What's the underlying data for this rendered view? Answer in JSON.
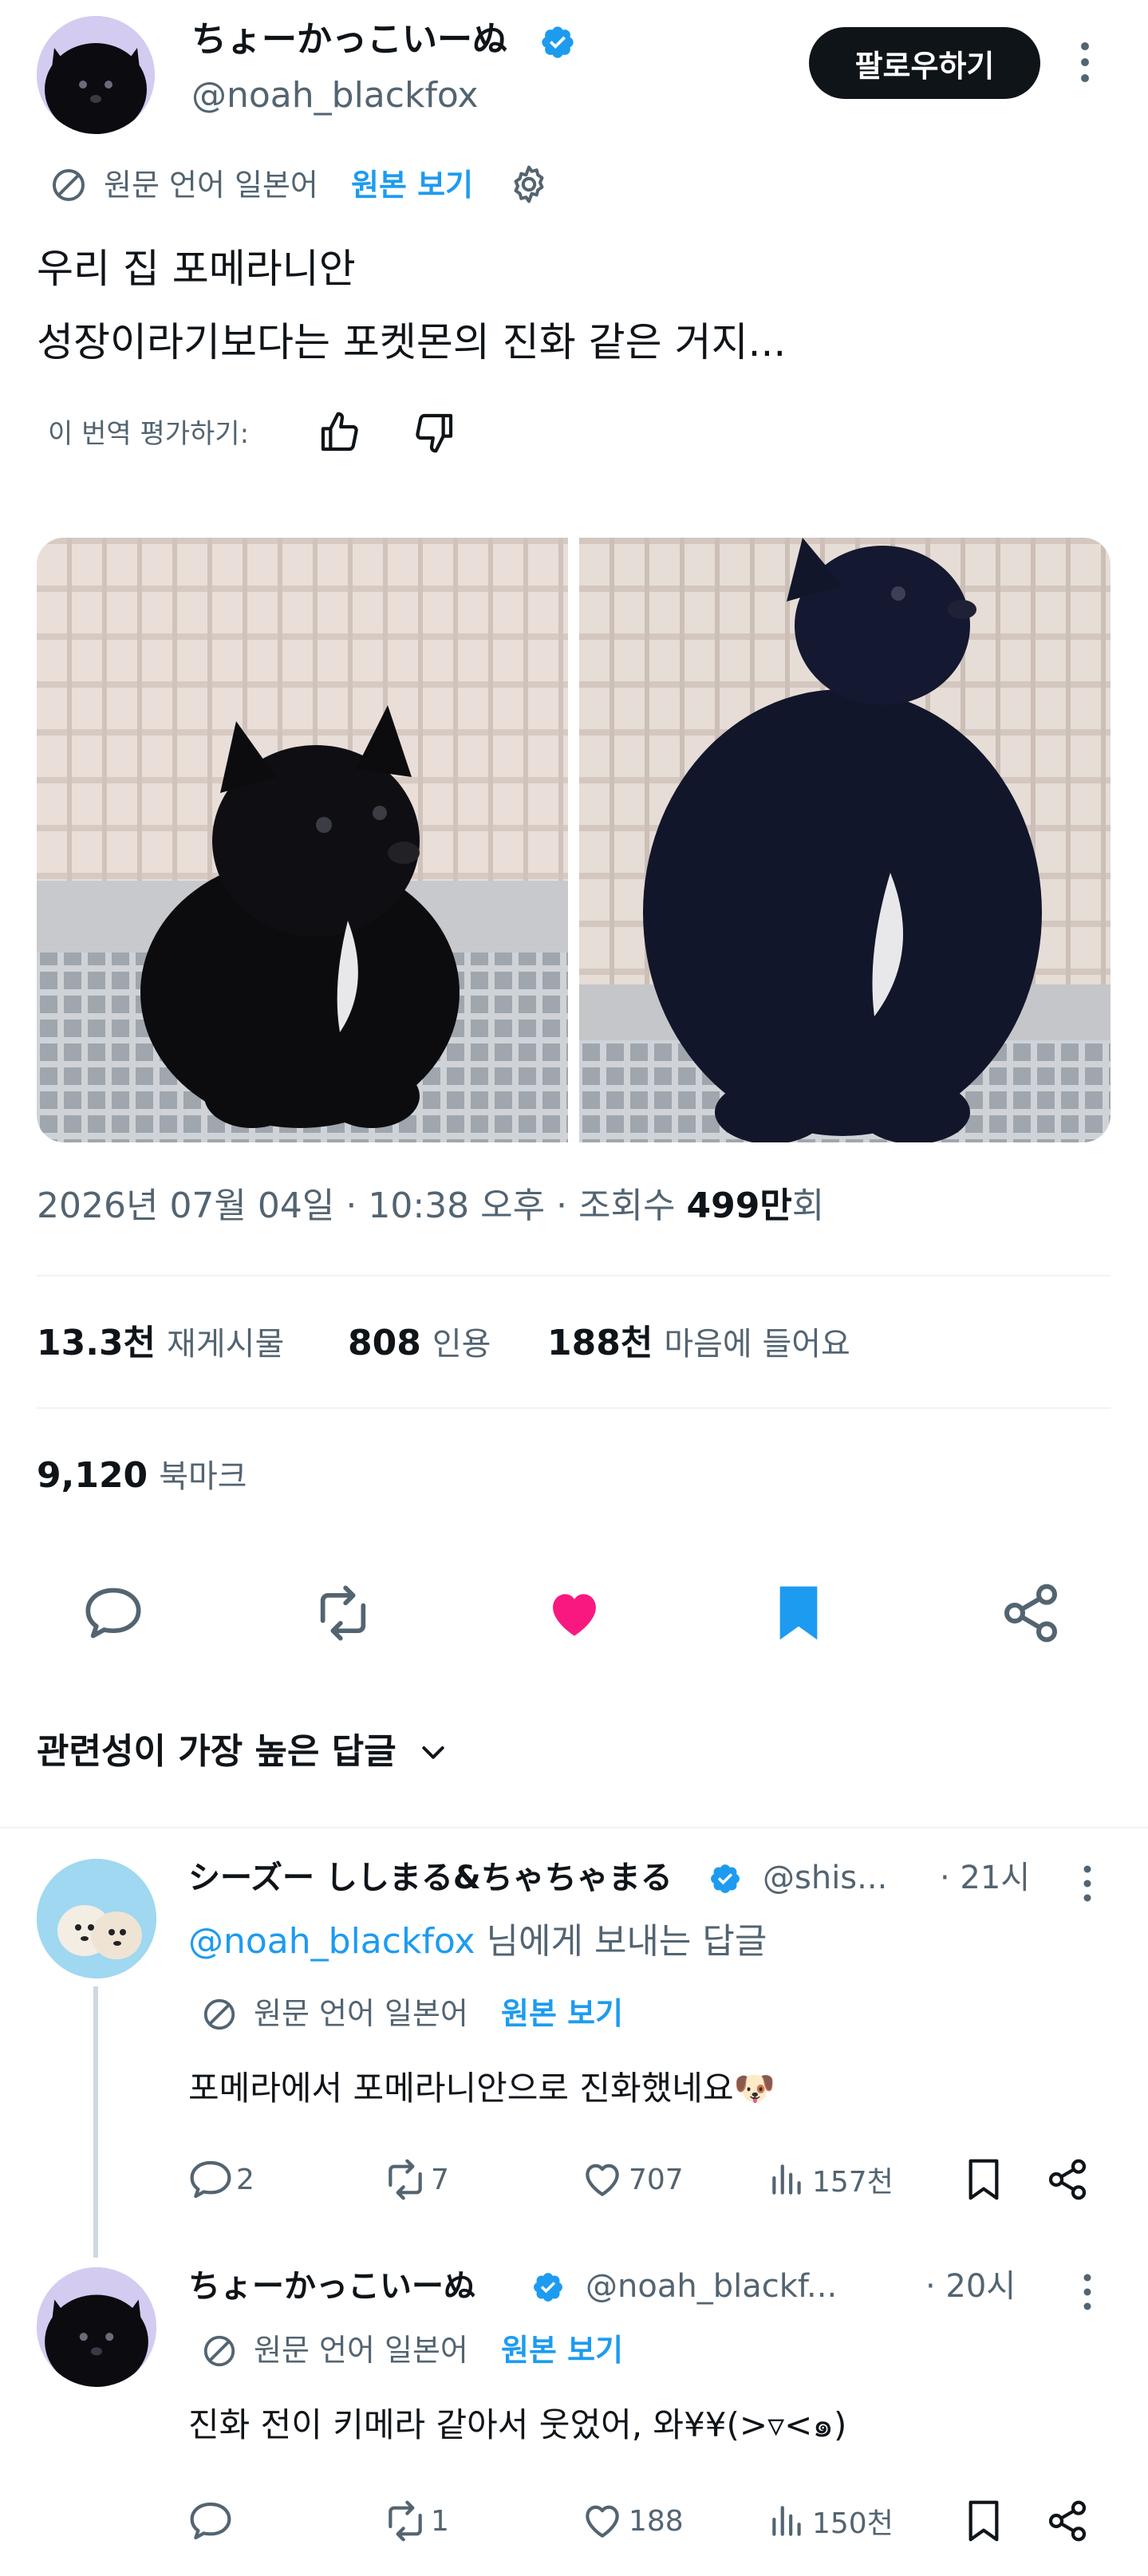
{
  "post": {
    "author_name": "ちょーかっこいーぬ",
    "author_handle": "@noah_blackfox",
    "follow_label": "팔로우하기",
    "translation_source": "원문 언어 일본어",
    "show_original": "원본 보기",
    "text_line1": "우리 집 포메라니안",
    "text_line2": "성장이라기보다는 포켓몬의 진화 같은 거지...",
    "rate_translation": "이 번역 평가하기:",
    "timestamp": "2026년 07월 04일 · 10:38 오후 · 조회수 ",
    "views": "499만",
    "views_suffix": "회",
    "stats": {
      "reposts_num": "13.3천",
      "reposts_label": "재게시물",
      "quotes_num": "808",
      "quotes_label": "인용",
      "likes_num": "188천",
      "likes_label": "마음에 들어요",
      "bookmarks_num": "9,120",
      "bookmarks_label": "북마크"
    }
  },
  "sort": {
    "label": "관련성이 가장 높은 답글"
  },
  "replies": [
    {
      "name": "シーズー ししまる&ちゃちゃまる",
      "handle": "@shis...",
      "time": "· 21시",
      "reply_to_handle": "@noah_blackfox",
      "reply_to_suffix": " 님에게 보내는 답글",
      "translation_source": "원문 언어 일본어",
      "show_original": "원본 보기",
      "text": "포메라에서 포메라니안으로 진화했네요🐶",
      "replies": "2",
      "reposts": "7",
      "likes": "707",
      "views": "157천"
    },
    {
      "name": "ちょーかっこいーぬ",
      "handle": "@noah_blackf...",
      "time": "· 20시",
      "translation_source": "원문 언어 일본어",
      "show_original": "원본 보기",
      "text": "진화 전이 키메라 같아서 웃었어, 와¥¥(>▿<๑)",
      "replies": "",
      "reposts": "1",
      "likes": "188",
      "views": "150천"
    }
  ],
  "colors": {
    "accent": "#1d9bf0",
    "like": "#f91880",
    "text": "#0f1419",
    "muted": "#536471"
  },
  "icons": [
    "verified-badge-icon",
    "more-icon",
    "translate-icon",
    "gear-icon",
    "thumbs-up-icon",
    "thumbs-down-icon",
    "reply-icon",
    "repost-icon",
    "heart-icon",
    "bookmark-icon",
    "share-icon",
    "chevron-down-icon",
    "views-icon"
  ]
}
